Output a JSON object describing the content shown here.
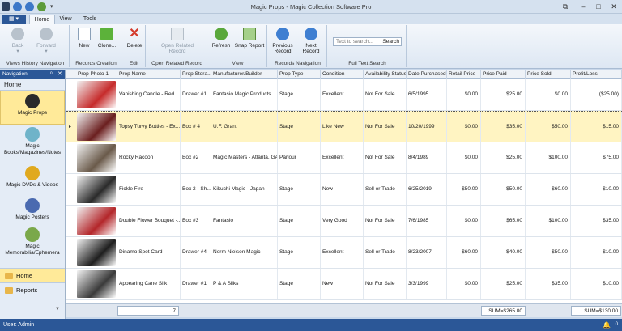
{
  "window": {
    "title": "Magic Props - Magic Collection Software Pro"
  },
  "ribbon": {
    "tabs": [
      "Home",
      "View",
      "Tools"
    ],
    "groups": {
      "views_history": {
        "label": "Views History Navigation",
        "back": "Back",
        "forward": "Forward"
      },
      "records_creation": {
        "label": "Records Creation",
        "new": "New",
        "clone": "Clone..."
      },
      "edit": {
        "label": "Edit",
        "delete": "Delete"
      },
      "open_related": {
        "label": "Open Related Record",
        "button": "Open Related Record"
      },
      "view": {
        "label": "View",
        "refresh": "Refresh",
        "snap": "Snap Report"
      },
      "records_nav": {
        "label": "Records Navigation",
        "previous": "Previous Record",
        "next": "Next Record"
      },
      "full_text": {
        "label": "Full Text Search",
        "placeholder": "Text to search...",
        "search_button": "Search"
      }
    }
  },
  "nav": {
    "header": "Navigation",
    "home_label": "Home",
    "items": [
      {
        "label": "Magic Props",
        "icon": "wand-hat-icon",
        "color": "#2a2a2a"
      },
      {
        "label": "Magic Books/Magazines/Notes",
        "icon": "books-icon",
        "color": "#6fb3c9"
      },
      {
        "label": "Magic DVDs & Videos",
        "icon": "dvd-icon",
        "color": "#e0a91e"
      },
      {
        "label": "Magic Posters",
        "icon": "poster-icon",
        "color": "#4a6ab0"
      },
      {
        "label": "Magic Memorabilia/Ephemera",
        "icon": "memorabilia-icon",
        "color": "#7aa84a"
      }
    ],
    "bottom": [
      {
        "label": "Home"
      },
      {
        "label": "Reports"
      }
    ]
  },
  "grid": {
    "columns": [
      "Prop Photo 1",
      "Prop Name",
      "Prop Stora...",
      "Manufacturer/Builder",
      "Prop Type",
      "Condition",
      "Availability Status",
      "Date Purchased",
      "Retail Price",
      "Price Paid",
      "Price Sold",
      "Profit/Loss"
    ],
    "rows": [
      {
        "photo_color": "#c62b2b",
        "name": "Vanishing Candle - Red",
        "storage": "Drawer #1",
        "maker": "Fantasio Magic Products",
        "type": "Stage",
        "condition": "Excellent",
        "status": "Not For Sale",
        "date": "6/5/1995",
        "retail": "$0.00",
        "paid": "$25.00",
        "sold": "$0.00",
        "profit": "($25.00)"
      },
      {
        "photo_color": "#6b1f1f",
        "name": "Topsy Turvy Bottles - Ex...",
        "storage": "Box # 4",
        "maker": "U.F. Grant",
        "type": "Stage",
        "condition": "Like New",
        "status": "Not For Sale",
        "date": "10/20/1999",
        "retail": "$0.00",
        "paid": "$35.00",
        "sold": "$50.00",
        "profit": "$15.00"
      },
      {
        "photo_color": "#6a5a4a",
        "name": "Rocky Racoon",
        "storage": "Box #2",
        "maker": "Magic Masters - Atlanta, GA",
        "type": "Parlour",
        "condition": "Excellent",
        "status": "Not For Sale",
        "date": "8/4/1989",
        "retail": "$0.00",
        "paid": "$25.00",
        "sold": "$100.00",
        "profit": "$75.00"
      },
      {
        "photo_color": "#2a2a2a",
        "name": "Fickle Fire",
        "storage": "Box 2 - Sh...",
        "maker": "Kikuchi Magic - Japan",
        "type": "Stage",
        "condition": "New",
        "status": "Sell or Trade",
        "date": "6/25/2019",
        "retail": "$50.00",
        "paid": "$50.00",
        "sold": "$60.00",
        "profit": "$10.00"
      },
      {
        "photo_color": "#b3262a",
        "name": "Double Flower Bouquet -...",
        "storage": "Box #3",
        "maker": "Fantasio",
        "type": "Stage",
        "condition": "Very Good",
        "status": "Not For Sale",
        "date": "7/6/1985",
        "retail": "$0.00",
        "paid": "$65.00",
        "sold": "$100.00",
        "profit": "$35.00"
      },
      {
        "photo_color": "#1e1e1e",
        "name": "Dinamo Spot Card",
        "storage": "Drawer #4",
        "maker": "Norm Nielson Magic",
        "type": "Stage",
        "condition": "Excellent",
        "status": "Sell or Trade",
        "date": "8/23/2007",
        "retail": "$60.00",
        "paid": "$40.00",
        "sold": "$50.00",
        "profit": "$10.00"
      },
      {
        "photo_color": "#3a3a3a",
        "name": "Appearing Cane Silk",
        "storage": "Drawer #1",
        "maker": "P & A Silks",
        "type": "Stage",
        "condition": "New",
        "status": "Not For Sale",
        "date": "3/3/1999",
        "retail": "$0.00",
        "paid": "$25.00",
        "sold": "$35.00",
        "profit": "$10.00"
      }
    ],
    "selected_row": 1
  },
  "footer": {
    "count": "7",
    "sum_paid": "SUM=$265.00",
    "sum_profit": "SUM=$130.00"
  },
  "status": {
    "user": "User: Admin",
    "notifications": "0"
  }
}
